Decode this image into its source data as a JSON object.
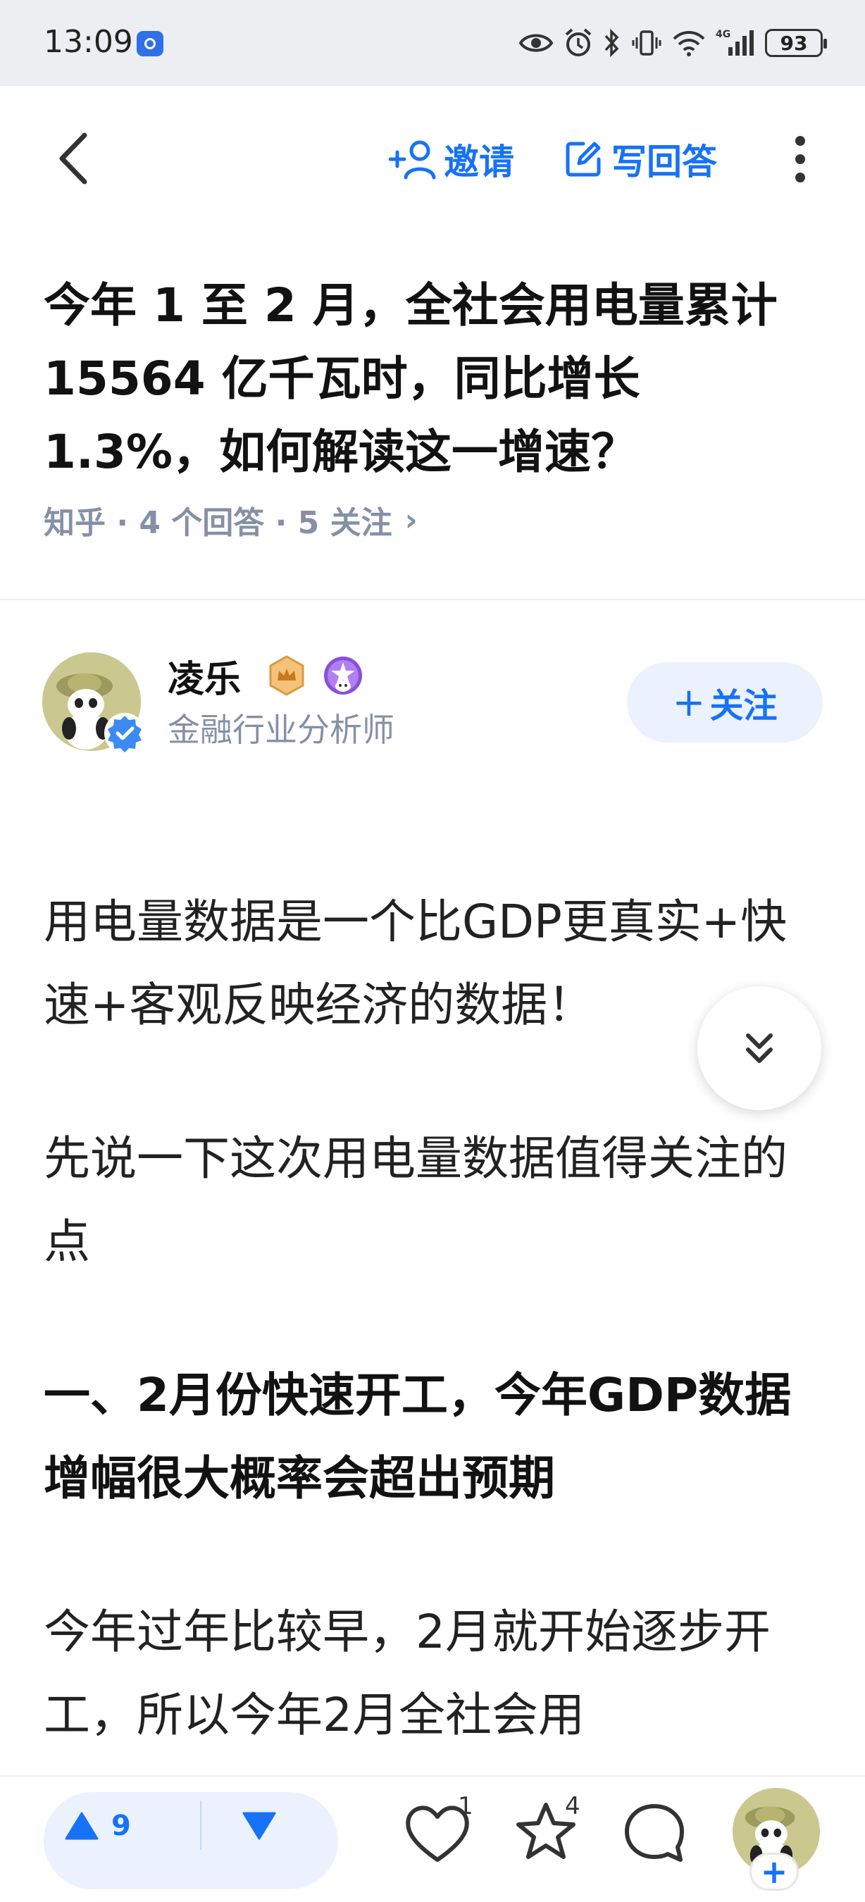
{
  "status_bar": {
    "time": "13:09",
    "battery": "93",
    "network": "4G"
  },
  "nav": {
    "invite_label": "邀请",
    "write_answer_label": "写回答"
  },
  "question": {
    "title": "今年 1 至 2 月，全社会用电量累计 15564 亿千瓦时，同比增长 1.3%，如何解读这一增速？",
    "meta": "知乎 · 4 个回答 · 5 关注",
    "meta_chevron": "›"
  },
  "author": {
    "name": "凌乐",
    "headline": "金融行业分析师",
    "follow_label": "关注",
    "follow_plus": "+"
  },
  "answer": {
    "p1": "用电量数据是一个比GDP更真实+快速+客观反映经济的数据！",
    "p2": "先说一下这次用电量数据值得关注的点",
    "h1": "一、2月份快速开工，今年GDP数据增幅很大概率会超出预期",
    "p3": "今年过年比较早，2月就开始逐步开工，所以今年2月全社会用"
  },
  "bottom_bar": {
    "upvotes": "9",
    "likes": "1",
    "favorites": "4",
    "plus": "+"
  },
  "colors": {
    "accent": "#1772f6",
    "accent_bg": "#ebf2fd",
    "meta_gray": "#8590a6",
    "status_bg": "#eceef1"
  }
}
